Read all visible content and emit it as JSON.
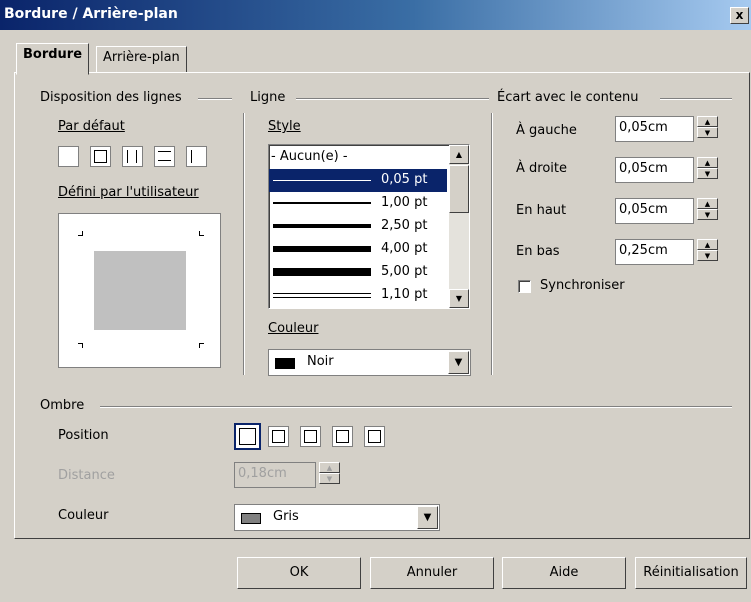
{
  "window": {
    "title": "Bordure / Arrière-plan",
    "close_glyph": "x"
  },
  "tabs": [
    {
      "label": "Bordure",
      "active": true
    },
    {
      "label": "Arrière-plan",
      "active": false
    }
  ],
  "line_arrangement": {
    "title": "Disposition des lignes",
    "default_label": "Par défaut",
    "user_defined_label": "Défini par l'utilisateur"
  },
  "line": {
    "title": "Ligne",
    "style_label": "Style",
    "styles": [
      "- Aucun(e) -",
      "0,05 pt",
      "1,00 pt",
      "2,50 pt",
      "4,00 pt",
      "5,00 pt",
      "1,10 pt"
    ],
    "selected_style": "0,05 pt",
    "color_label": "Couleur",
    "color_value": "Noir",
    "color_swatch": "#000000"
  },
  "spacing": {
    "title": "Écart avec le contenu",
    "left_label": "À gauche",
    "left_value": "0,05cm",
    "right_label": "À droite",
    "right_value": "0,05cm",
    "top_label": "En haut",
    "top_value": "0,05cm",
    "bottom_label": "En bas",
    "bottom_value": "0,25cm",
    "sync_label": "Synchroniser",
    "sync_checked": false
  },
  "shadow": {
    "title": "Ombre",
    "position_label": "Position",
    "distance_label": "Distance",
    "distance_value": "0,18cm",
    "color_label": "Couleur",
    "color_value": "Gris",
    "color_swatch": "#808080"
  },
  "buttons": {
    "ok": "OK",
    "cancel": "Annuler",
    "help": "Aide",
    "reset": "Réinitialisation"
  },
  "colors": {
    "titlebar_start": "#0a246a",
    "face": "#d4d0c8",
    "selection": "#0a246a"
  }
}
